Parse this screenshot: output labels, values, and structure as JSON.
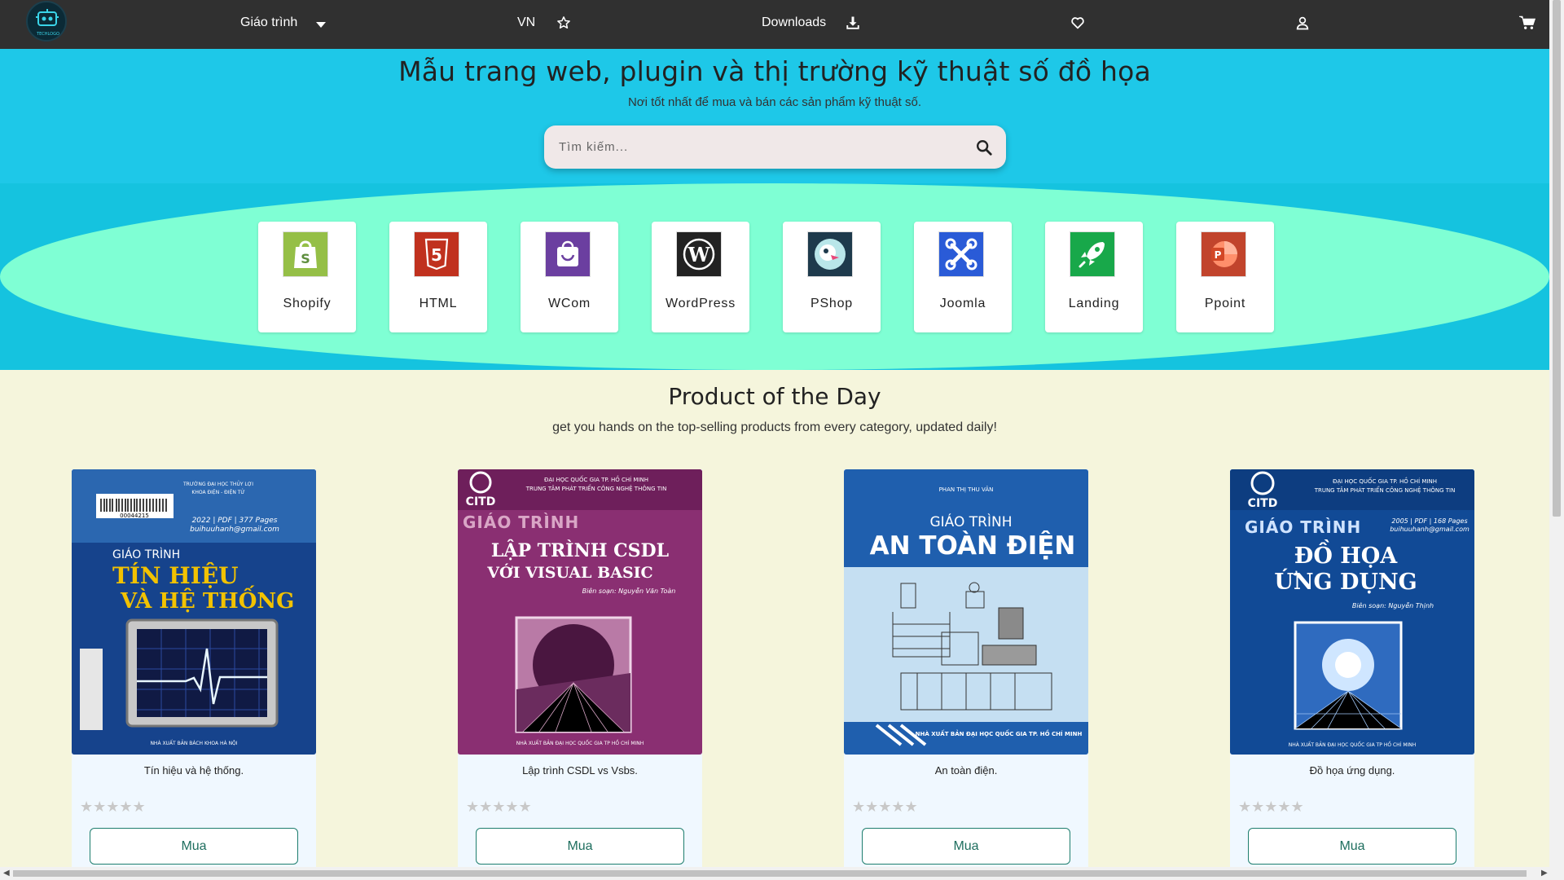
{
  "nav": {
    "logo_text": "TECHLOGO",
    "courses_label": "Giáo trình",
    "lang_label": "VN",
    "downloads_label": "Downloads"
  },
  "hero": {
    "title": "Mẫu trang web, plugin và thị trường kỹ thuật số đồ họa",
    "subtitle": "Nơi tốt nhất để mua và bán các sản phẩm kỹ thuật số.",
    "search_placeholder": "Tìm kiếm..."
  },
  "categories": [
    {
      "label": "Shopify",
      "icon": "shopify-icon",
      "color": "#95bf47"
    },
    {
      "label": "HTML",
      "icon": "html5-icon",
      "color": "#c0311e"
    },
    {
      "label": "WCom",
      "icon": "woocommerce-icon",
      "color": "#6b3fa0"
    },
    {
      "label": "WordPress",
      "icon": "wordpress-icon",
      "color": "#222222"
    },
    {
      "label": "PShop",
      "icon": "prestashop-icon",
      "color": "#1e3a4c"
    },
    {
      "label": "Joomla",
      "icon": "joomla-icon",
      "color": "#2a5bd7"
    },
    {
      "label": "Landing",
      "icon": "rocket-icon",
      "color": "#18a84a"
    },
    {
      "label": "Ppoint",
      "icon": "powerpoint-icon",
      "color": "#c1442c"
    }
  ],
  "product_section": {
    "title": "Product of the Day",
    "subtitle": "get you hands on the top-selling products from every category, updated daily!"
  },
  "products": [
    {
      "name": "Tín hiệu và hệ thống.",
      "cover": {
        "line1": "GIÁO TRÌNH",
        "line2": "TÍN HIỆU",
        "line3": "VÀ HỆ THỐNG",
        "top": "TRƯỜNG ĐẠI HỌC THỦY LỢI",
        "top2": "KHOA ĐIỆN - ĐIỆN TỬ",
        "meta": "2022 | PDF | 377 Pages",
        "email": "buihuuhanh@gmail.com",
        "barcode": "00044215",
        "publisher": "NHÀ XUẤT BẢN BÁCH KHOA HÀ NỘI"
      },
      "rating": 0,
      "stars": "★★★★★",
      "buy_label": "Mua"
    },
    {
      "name": "Lập trình CSDL vs Vsbs.",
      "cover": {
        "line1": "GIÁO TRÌNH",
        "line2": "LẬP TRÌNH CSDL",
        "line3": "VỚI VISUAL BASIC",
        "top": "ĐẠI HỌC QUỐC GIA TP. HỒ CHÍ MINH",
        "top2": "TRUNG TÂM PHÁT TRIỂN CÔNG NGHỆ THÔNG TIN",
        "org": "CITD",
        "authors": "Biên soạn: Nguyễn Văn Toàn",
        "publisher": "NHÀ XUẤT BẢN ĐẠI HỌC QUỐC GIA TP HỒ CHÍ MINH"
      },
      "rating": 0,
      "stars": "★★★★★",
      "buy_label": "Mua"
    },
    {
      "name": "An toàn điện.",
      "cover": {
        "line1": "GIÁO TRÌNH",
        "line2": "AN TOÀN ĐIỆN",
        "top": "PHAN THỊ THU VÂN",
        "publisher": "NHÀ XUẤT BẢN ĐẠI HỌC QUỐC GIA TP. HỒ CHÍ MINH"
      },
      "rating": 0,
      "stars": "★★★★★",
      "buy_label": "Mua"
    },
    {
      "name": "Đồ họa ứng dụng.",
      "cover": {
        "line1": "GIÁO TRÌNH",
        "line2": "ĐỒ HỌA",
        "line3": "ỨNG DỤNG",
        "top": "ĐẠI HỌC QUỐC GIA TP. HỒ CHÍ MINH",
        "top2": "TRUNG TÂM PHÁT TRIỂN CÔNG NGHỆ THÔNG TIN",
        "org": "CITD",
        "meta": "2005 | PDF | 168 Pages",
        "email": "buihuuhanh@gmail.com",
        "authors": "Biên soạn: Nguyễn Thịnh",
        "publisher": "NHÀ XUẤT BẢN ĐẠI HỌC QUỐC GIA TP HỒ CHÍ MINH"
      },
      "rating": 0,
      "stars": "★★★★★",
      "buy_label": "Mua"
    }
  ],
  "colors": {
    "nav_bg": "#303030",
    "hero_bg": "#1ec8e8",
    "band_ellipse": "#7fffd4",
    "page_bg": "#f5f5dc",
    "card_bg": "#f0f8ff",
    "buy_border": "#1e7e6e"
  }
}
